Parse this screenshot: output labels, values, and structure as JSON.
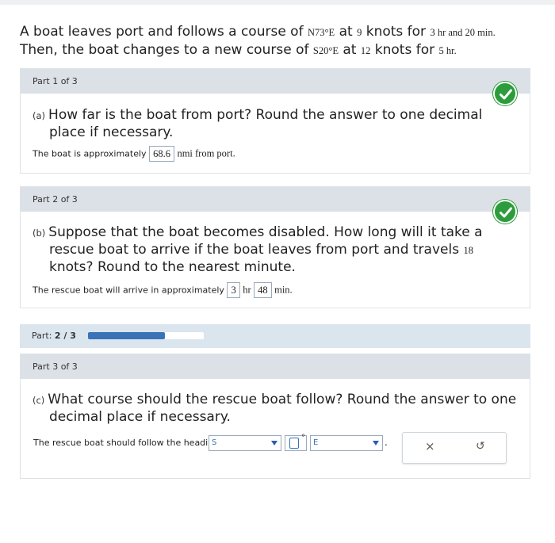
{
  "intro": {
    "line1_a": "A boat leaves port and follows a course of",
    "course1": "N73°E",
    "line1_b": "at",
    "speed1": "9",
    "line1_c": "knots for",
    "time1": "3 hr and 20 min.",
    "line2_a": "Then, the boat changes to a new course of",
    "course2": "S20°E",
    "line2_b": "at",
    "speed2": "12",
    "line2_c": "knots for",
    "time2": "5 hr."
  },
  "part1": {
    "header": "Part 1 of 3",
    "label": "(a)",
    "question_l1": "How far is the boat from port? Round the answer to one decimal",
    "question_l2": "place if necessary.",
    "answer_prefix": "The boat is approximately",
    "answer_value": "68.6",
    "answer_unit": "nmi from port."
  },
  "part2": {
    "header": "Part 2 of 3",
    "label": "(b)",
    "question_l1": "Suppose that the boat becomes disabled. How long will it take a",
    "question_l2a": "rescue boat to arrive if the boat leaves from port and travels",
    "question_l2_num": "18",
    "question_l3": "knots? Round to the nearest minute.",
    "answer_prefix": "The rescue boat will arrive in approximately",
    "hours_value": "3",
    "hours_unit": "hr",
    "minutes_value": "48",
    "minutes_unit": "min."
  },
  "progress": {
    "label": "Part:",
    "value": "2 / 3",
    "fraction": 0.667,
    "fill_color": "#3a73b8"
  },
  "part3": {
    "header": "Part 3 of 3",
    "label": "(c)",
    "question_l1": "What course should the rescue boat follow? Round the answer to one",
    "question_l2": "decimal place if necessary.",
    "answer_prefix": "The rescue boat should follow the heading",
    "select1_value": "S",
    "degree_symbol": "°",
    "select2_value": "E",
    "period": ".",
    "clear_icon": "×",
    "undo_icon": "↺"
  },
  "colors": {
    "accent": "#3a73b8",
    "check_green": "#2d9c3c",
    "header_gray": "#dbe1e6"
  }
}
